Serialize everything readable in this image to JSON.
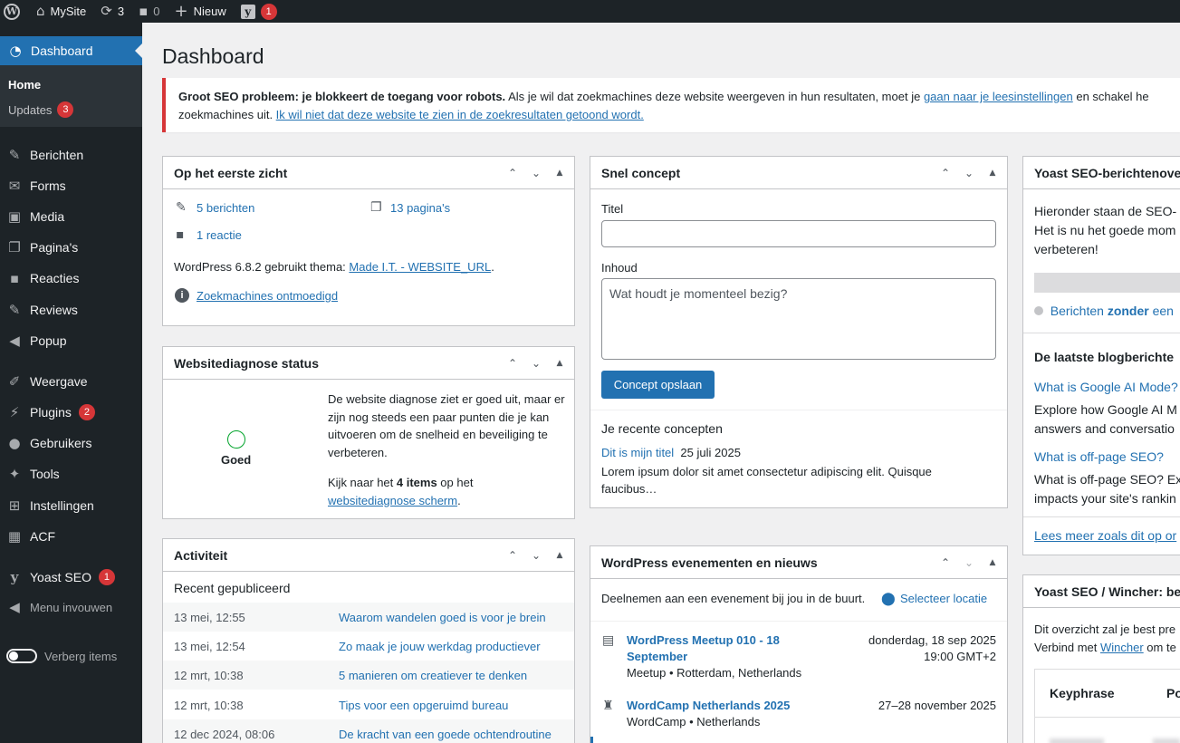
{
  "adminbar": {
    "site_name": "MySite",
    "updates_count": "3",
    "comments_count": "0",
    "new_label": "Nieuw",
    "yoast_badge": "1"
  },
  "sidebar": {
    "dashboard": "Dashboard",
    "home": "Home",
    "updates": "Updates",
    "updates_badge": "3",
    "items": [
      {
        "label": "Berichten",
        "icon": "pushpin-icon"
      },
      {
        "label": "Forms",
        "icon": "envelope-icon"
      },
      {
        "label": "Media",
        "icon": "media-icon"
      },
      {
        "label": "Pagina's",
        "icon": "page-icon"
      },
      {
        "label": "Reacties",
        "icon": "comment-icon"
      },
      {
        "label": "Reviews",
        "icon": "pushpin-icon"
      },
      {
        "label": "Popup",
        "icon": "megaphone-icon"
      },
      {
        "label": "Weergave",
        "icon": "brush-icon"
      },
      {
        "label": "Plugins",
        "icon": "plug-icon"
      },
      {
        "label": "Gebruikers",
        "icon": "user-icon"
      },
      {
        "label": "Tools",
        "icon": "wrench-icon"
      },
      {
        "label": "Instellingen",
        "icon": "sliders-icon"
      },
      {
        "label": "ACF",
        "icon": "table-icon"
      },
      {
        "label": "Yoast SEO",
        "icon": "yoast-icon"
      }
    ],
    "plugins_badge": "2",
    "yoast_badge": "1",
    "collapse": "Menu invouwen",
    "hide_items": "Verberg items"
  },
  "page_title": "Dashboard",
  "notice": {
    "bold": "Groot SEO probleem: je blokkeert de toegang voor robots.",
    "text1": " Als je wil dat zoekmachines deze website weergeven in hun resultaten, moet je ",
    "link1": "gaan naar je leesinstellingen",
    "text2": " en schakel he",
    "line2": "zoekmachines uit. ",
    "link2": "Ik wil niet dat deze website te zien in de zoekresultaten getoond wordt."
  },
  "glance": {
    "title": "Op het eerste zicht",
    "posts": "5 berichten",
    "pages": "13 pagina's",
    "comments": "1 reactie",
    "theme_text": "WordPress 6.8.2 gebruikt thema: ",
    "theme_link": "Made I.T. - WEBSITE_URL",
    "theme_end": ".",
    "search_discouraged": "Zoekmachines ontmoedigd"
  },
  "sitehealth": {
    "title": "Websitediagnose status",
    "status": "Goed",
    "desc": "De website diagnose ziet er goed uit, maar er zijn nog steeds een paar punten die je kan uitvoeren om de snelheid en beveiliging te verbeteren.",
    "look_pre": "Kijk naar het ",
    "look_bold": "4 items",
    "look_post": " op het",
    "look_link": "websitediagnose scherm",
    "look_end": "."
  },
  "activity": {
    "title": "Activiteit",
    "recent": "Recent gepubliceerd",
    "rows": [
      {
        "date": "13 mei, 12:55",
        "title": "Waarom wandelen goed is voor je brein"
      },
      {
        "date": "13 mei, 12:54",
        "title": "Zo maak je jouw werkdag productiever"
      },
      {
        "date": "12 mrt, 10:38",
        "title": "5 manieren om creatiever te denken"
      },
      {
        "date": "12 mrt, 10:38",
        "title": "Tips voor een opgeruimd bureau"
      },
      {
        "date": "12 dec 2024, 08:06",
        "title": "De kracht van een goede ochtendroutine"
      }
    ]
  },
  "quickdraft": {
    "title": "Snel concept",
    "title_label": "Titel",
    "content_label": "Inhoud",
    "content_placeholder": "Wat houdt je momenteel bezig?",
    "save": "Concept opslaan",
    "recent_heading": "Je recente concepten",
    "draft_title": "Dit is mijn titel",
    "draft_date": "25 juli 2025",
    "draft_excerpt_1": "Lorem ipsum dolor sit amet consectetur adipiscing elit. Quisque",
    "draft_excerpt_2": "faucibus…"
  },
  "events": {
    "title": "WordPress evenementen en nieuws",
    "intro": "Deelnemen aan een evenement bij jou in de buurt.",
    "select_location": "Selecteer locatie",
    "items": [
      {
        "title_1": "WordPress Meetup 010 - 18",
        "title_2": "September",
        "meta": "Meetup • Rotterdam, Netherlands",
        "date": "donderdag, 18 sep 2025",
        "time": "19:00 GMT+2"
      },
      {
        "title_1": "WordCamp Netherlands 2025",
        "meta": "WordCamp • Netherlands",
        "date": "27–28 november 2025"
      }
    ]
  },
  "yoast_overview": {
    "title": "Yoast SEO-berichtenove",
    "line1": "Hieronder staan de SEO-",
    "line2": "Het is nu het goede mom",
    "line3": "verbeteren!",
    "posts_pre": "Berichten ",
    "posts_bold": "zonder",
    "posts_post": " een",
    "blog_heading": "De laatste blogberichte",
    "post1_title": "What is Google AI Mode?",
    "post1_l1": "Explore how Google AI M",
    "post1_l2": "answers and conversatio",
    "post2_title": "What is off-page SEO?",
    "post2_l1": "What is off-page SEO? Ex",
    "post2_l2": "impacts your site's rankin",
    "read_more": "Lees meer zoals dit op or"
  },
  "wincher": {
    "title": "Yoast SEO / Wincher: be",
    "line1": "Dit overzicht zal je best pre",
    "line2_pre": "Verbind met ",
    "line2_link": "Wincher",
    "line2_post": " om te",
    "col1": "Keyphrase",
    "col2": "Posit"
  }
}
